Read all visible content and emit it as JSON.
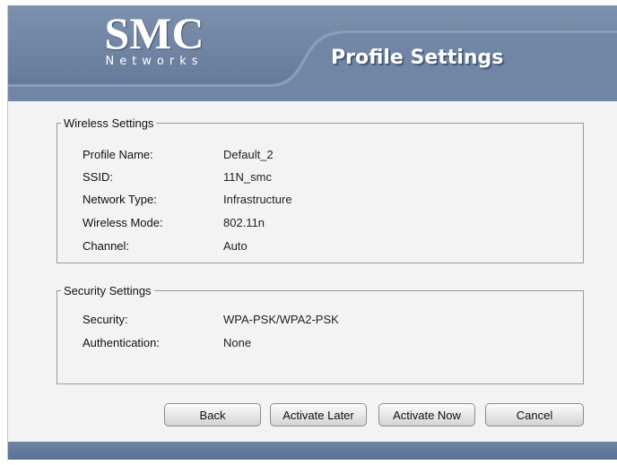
{
  "header": {
    "logo_main": "SMC",
    "logo_sub": "Networks",
    "title": "Profile Settings"
  },
  "wireless": {
    "legend": "Wireless Settings",
    "rows": [
      {
        "label": "Profile Name:",
        "value": "Default_2"
      },
      {
        "label": "SSID:",
        "value": "11N_smc"
      },
      {
        "label": "Network Type:",
        "value": "Infrastructure"
      },
      {
        "label": "Wireless Mode:",
        "value": "802.11n"
      },
      {
        "label": "Channel:",
        "value": "Auto"
      }
    ]
  },
  "security": {
    "legend": "Security Settings",
    "rows": [
      {
        "label": "Security:",
        "value": "WPA-PSK/WPA2-PSK"
      },
      {
        "label": "Authentication:",
        "value": "None"
      }
    ]
  },
  "buttons": {
    "back": "Back",
    "activate_later": "Activate Later",
    "activate_now": "Activate Now",
    "cancel": "Cancel"
  },
  "colors": {
    "header": "#6b819f",
    "footer": "#5a7196",
    "background": "#f3f3f3"
  }
}
